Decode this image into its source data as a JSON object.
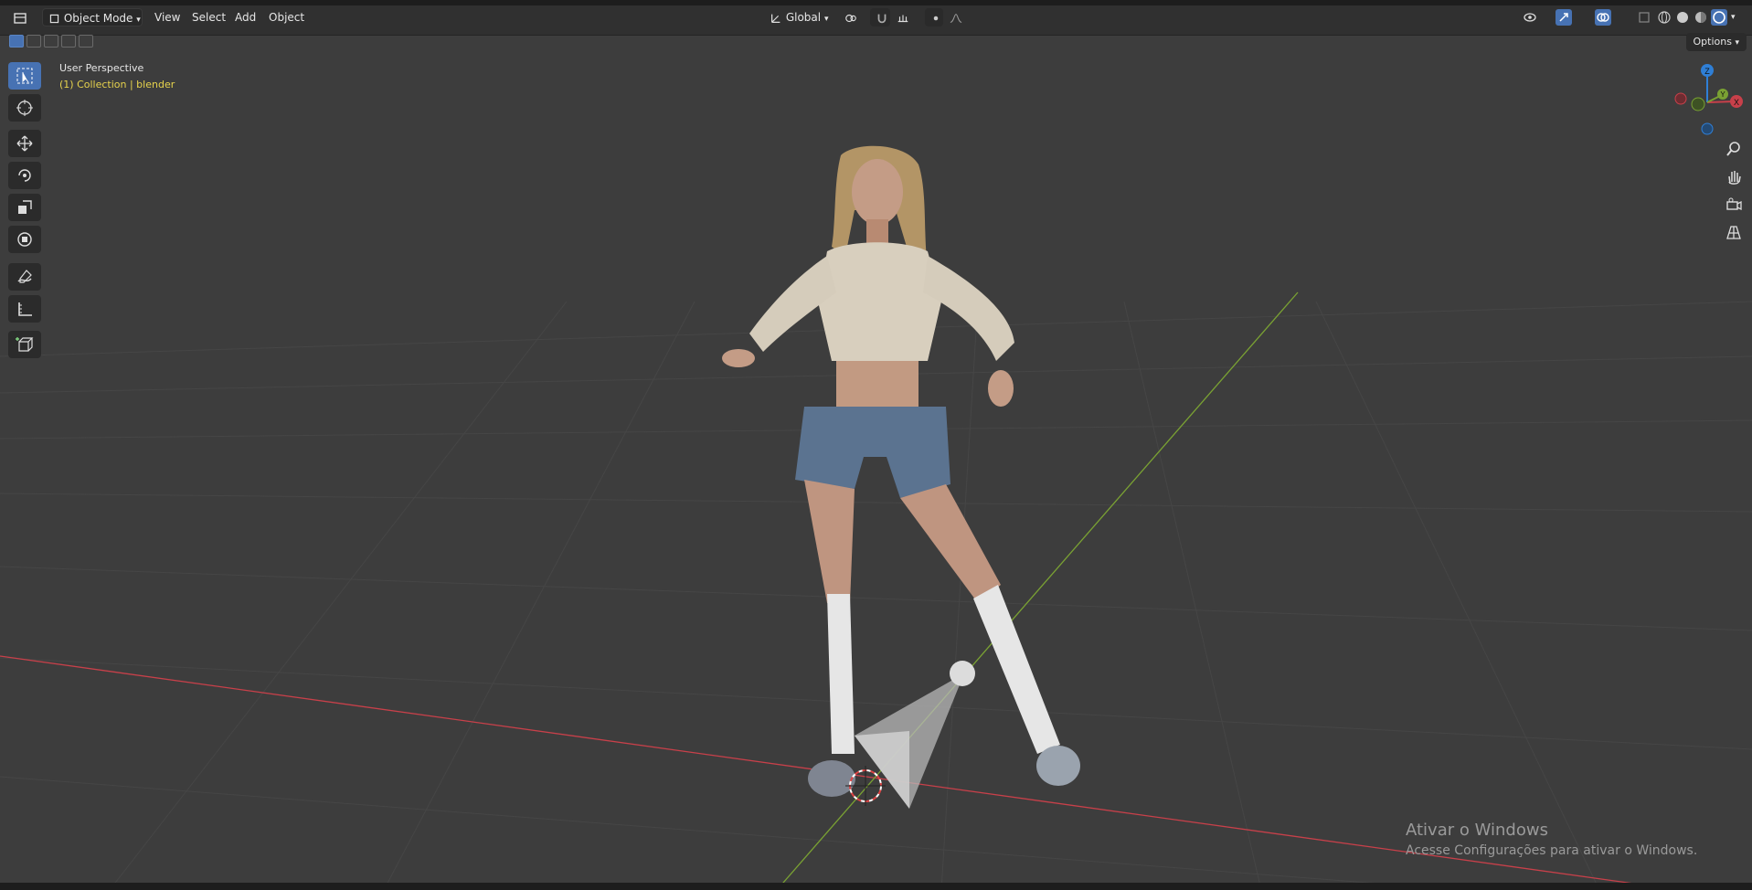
{
  "header": {
    "mode": "Object Mode",
    "menus": [
      "View",
      "Select",
      "Add",
      "Object"
    ],
    "orientation": "Global",
    "options_label": "Options"
  },
  "viewport": {
    "view_name": "User Perspective",
    "collection_info": "(1) Collection | blender"
  },
  "gizmo": {
    "z": "Z",
    "y": "Y",
    "x": "X"
  },
  "watermark": {
    "title": "Ativar o Windows",
    "subtitle": "Acesse Configurações para ativar o Windows."
  },
  "colors": {
    "viewport_bg": "#3d3d3d",
    "header_bg": "#303030",
    "accent": "#4772b3",
    "x_axis": "#c8404a",
    "y_axis": "#7aa233",
    "z_axis": "#2f7fd6",
    "collection_text": "#e7d34d"
  },
  "icons": {
    "editor_type": "editor-type-icon",
    "tools": [
      "select-box-icon",
      "cursor-icon",
      "move-icon",
      "rotate-icon",
      "scale-icon",
      "transform-icon",
      "annotate-icon",
      "measure-icon",
      "add-cube-icon"
    ],
    "nav": [
      "zoom-icon",
      "hand-pan-icon",
      "camera-view-icon",
      "grid-view-icon"
    ]
  }
}
